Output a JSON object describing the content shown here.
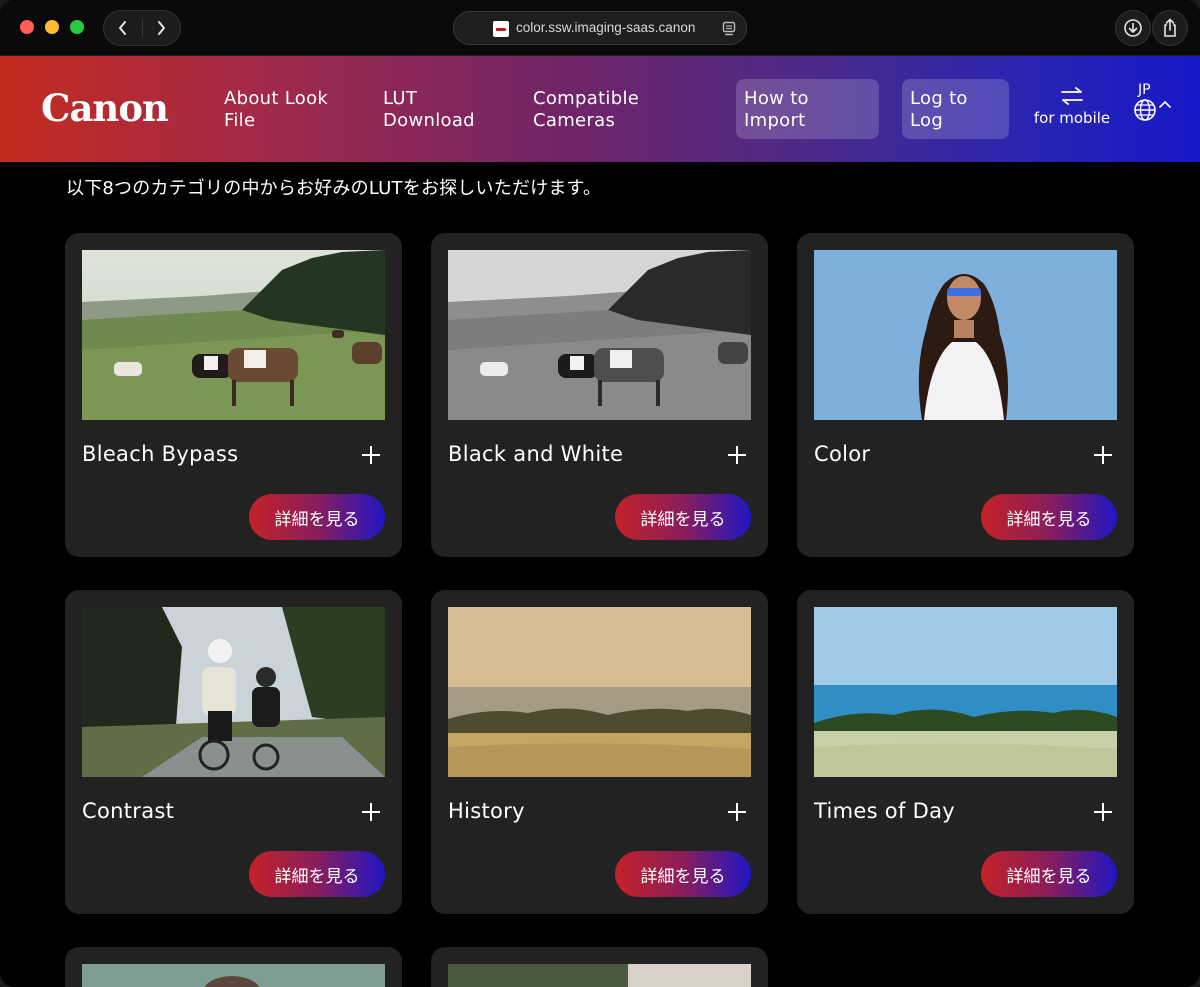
{
  "browser": {
    "url": "color.ssw.imaging-saas.canon",
    "back_icon": "chevron-left-icon",
    "forward_icon": "chevron-right-icon",
    "download_icon": "download-icon",
    "share_icon": "share-icon"
  },
  "header": {
    "logo": "Canon",
    "nav": {
      "about_line1": "About Look",
      "about_line2": "File",
      "lut_line1": "LUT",
      "lut_line2": "Download",
      "compat_line1": "Compatible",
      "compat_line2": "Cameras",
      "import_line1": "How to",
      "import_line2": "Import",
      "log_line1": "Log to",
      "log_line2": "Log"
    },
    "mobile_label": "for mobile",
    "language": "JP",
    "colors": {
      "gradient_start": "#c42b1f",
      "gradient_end": "#1818c8"
    }
  },
  "main": {
    "intro": "以下8つのカテゴリの中からお好みのLUTをお探しいただけます。",
    "detail_label": "詳細を見る",
    "cards": [
      {
        "title": "Bleach Bypass",
        "image": "cows grazing on hillside, desaturated"
      },
      {
        "title": "Black and White",
        "image": "cows grazing on hillside, monochrome"
      },
      {
        "title": "Color",
        "image": "woman with sunglasses against blue sky"
      },
      {
        "title": "Contrast",
        "image": "two cyclists on mountain road"
      },
      {
        "title": "History",
        "image": "sepia sea and grassland"
      },
      {
        "title": "Times of Day",
        "image": "blue sea and meadow"
      },
      {
        "title": "",
        "image": "partially visible"
      },
      {
        "title": "",
        "image": "partially visible"
      }
    ],
    "button_gradient": [
      "#c42226",
      "#2016c4"
    ]
  }
}
